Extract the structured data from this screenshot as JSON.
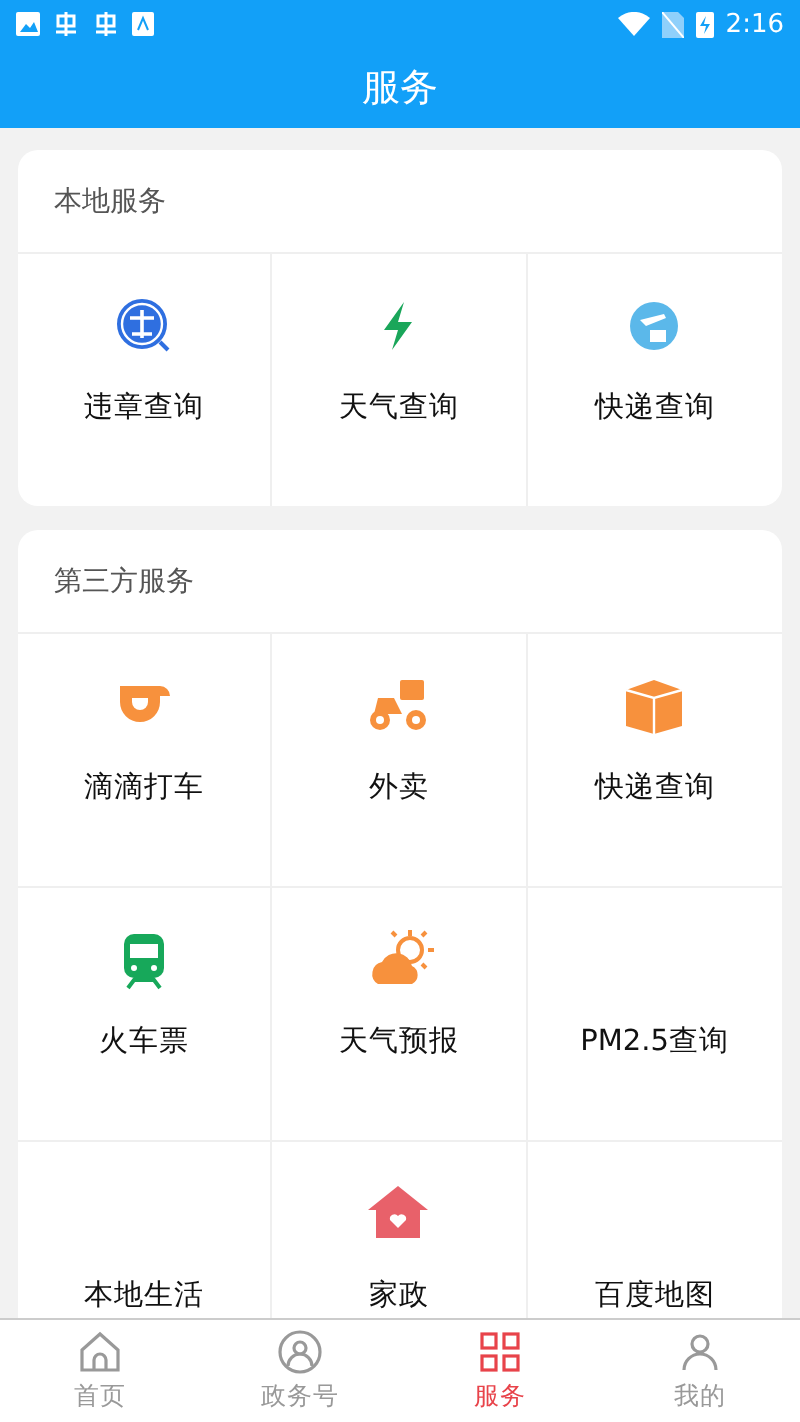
{
  "status_bar": {
    "time": "2:16"
  },
  "header": {
    "title": "服务"
  },
  "sections": [
    {
      "title": "本地服务",
      "items": [
        {
          "label": "违章查询",
          "kind": "violation"
        },
        {
          "label": "天气查询",
          "kind": "bolt"
        },
        {
          "label": "快递查询",
          "kind": "globe"
        }
      ]
    },
    {
      "title": "第三方服务",
      "items": [
        {
          "label": "滴滴打车",
          "kind": "ride"
        },
        {
          "label": "外卖",
          "kind": "scooter"
        },
        {
          "label": "快递查询",
          "kind": "box"
        },
        {
          "label": "火车票",
          "kind": "train"
        },
        {
          "label": "天气预报",
          "kind": "weather"
        },
        {
          "label": "PM2.5查询",
          "kind": "plain"
        },
        {
          "label": "本地生活",
          "kind": "plain"
        },
        {
          "label": "家政",
          "kind": "house"
        },
        {
          "label": "百度地图",
          "kind": "plain"
        }
      ]
    }
  ],
  "tabs": [
    {
      "label": "首页",
      "kind": "home",
      "selected": false
    },
    {
      "label": "政务号",
      "kind": "person",
      "selected": false
    },
    {
      "label": "服务",
      "kind": "grid",
      "selected": true
    },
    {
      "label": "我的",
      "kind": "user",
      "selected": false
    }
  ]
}
